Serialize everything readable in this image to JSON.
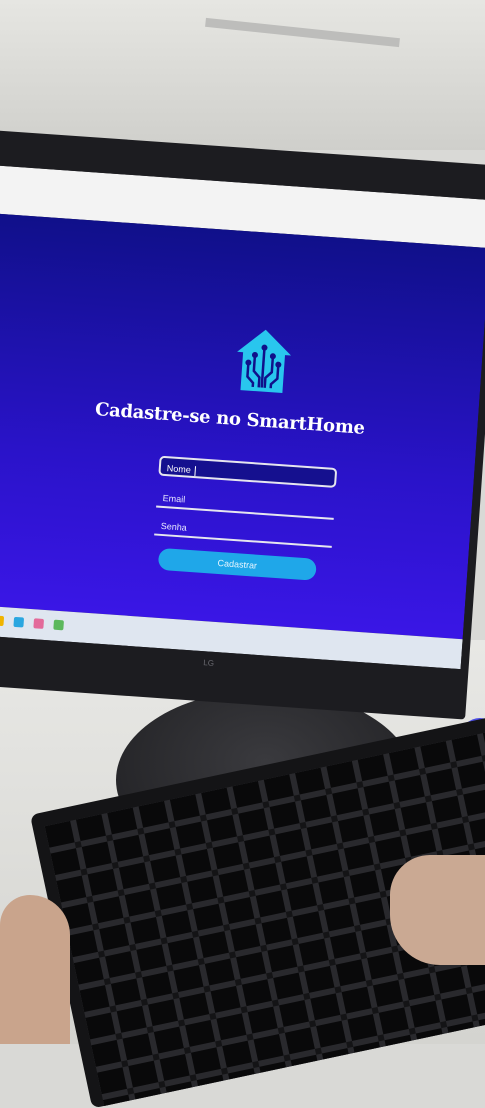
{
  "signup": {
    "title": "Cadastre-se no SmartHome",
    "name_placeholder": "Nome",
    "email_placeholder": "Email",
    "password_placeholder": "Senha",
    "submit_label": "Cadastrar"
  },
  "icons": {
    "logo": "smart-home-circuit-icon"
  },
  "colors": {
    "page_bg_top": "#10108a",
    "page_bg_bottom": "#3a16e6",
    "button_bg": "#1fa7e9",
    "logo_color": "#29c6ee",
    "text": "#ffffff"
  },
  "monitor": {
    "brand": "LG"
  }
}
